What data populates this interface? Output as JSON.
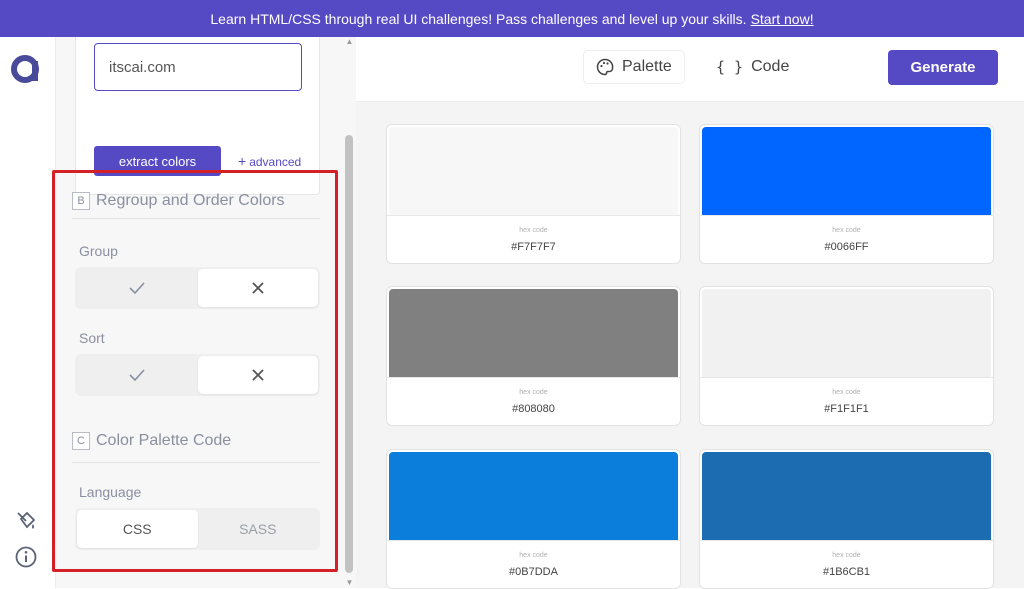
{
  "banner": {
    "text": "Learn HTML/CSS through real UI challenges! Pass challenges and level up your skills.",
    "link": "Start now!"
  },
  "rail": {
    "logo_icon": "app-logo-icon",
    "icons": [
      "paint-bucket-icon",
      "info-icon"
    ]
  },
  "extract": {
    "url_value": "itscai.com",
    "button_label": "extract colors",
    "advanced_label": "advanced"
  },
  "regroup": {
    "letter": "B",
    "title": "Regroup and Order Colors",
    "group_label": "Group",
    "sort_label": "Sort",
    "group_selected": "off",
    "sort_selected": "off"
  },
  "code_section": {
    "letter": "C",
    "title": "Color Palette Code",
    "language_label": "Language",
    "options": [
      "CSS",
      "SASS"
    ],
    "selected": "CSS"
  },
  "tabs": {
    "palette": "Palette",
    "code": "Code",
    "code_glyph": "{ }",
    "active": "Palette"
  },
  "generate_label": "Generate",
  "swatches": [
    {
      "caption": "hex code",
      "hex": "#F7F7F7",
      "color": "#F7F7F7"
    },
    {
      "caption": "hex code",
      "hex": "#0066FF",
      "color": "#0066FF"
    },
    {
      "caption": "hex code",
      "hex": "#808080",
      "color": "#808080"
    },
    {
      "caption": "hex code",
      "hex": "#F1F1F1",
      "color": "#F1F1F1"
    },
    {
      "caption": "hex code",
      "hex": "#0B7DDA",
      "color": "#0B7DDA"
    },
    {
      "caption": "hex code",
      "hex": "#1B6CB1",
      "color": "#1B6CB1"
    }
  ],
  "colors": {
    "accent": "#5649C4",
    "highlight": "#D42027"
  }
}
